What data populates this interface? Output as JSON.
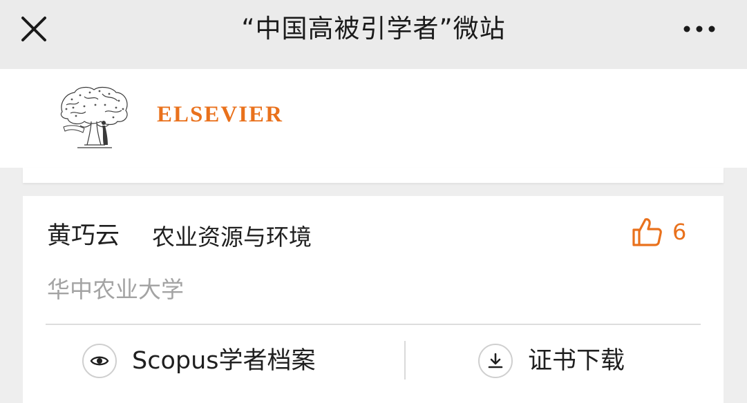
{
  "nav": {
    "title": "“中国高被引学者”微站",
    "close_icon": "close-icon",
    "more_icon": "more-options-icon"
  },
  "header": {
    "logo_text": "ELSEVIER",
    "logo_icon": "elsevier-tree-logo",
    "brand_color": "#e9711c"
  },
  "scholar": {
    "name": "黄巧云",
    "field": "农业资源与环境",
    "university": "华中农业大学",
    "likes": "6",
    "like_icon": "thumbs-up-icon"
  },
  "actions": {
    "scopus_label": "Scopus学者档案",
    "scopus_icon": "eye-icon",
    "certificate_label": "证书下载",
    "certificate_icon": "download-icon"
  }
}
